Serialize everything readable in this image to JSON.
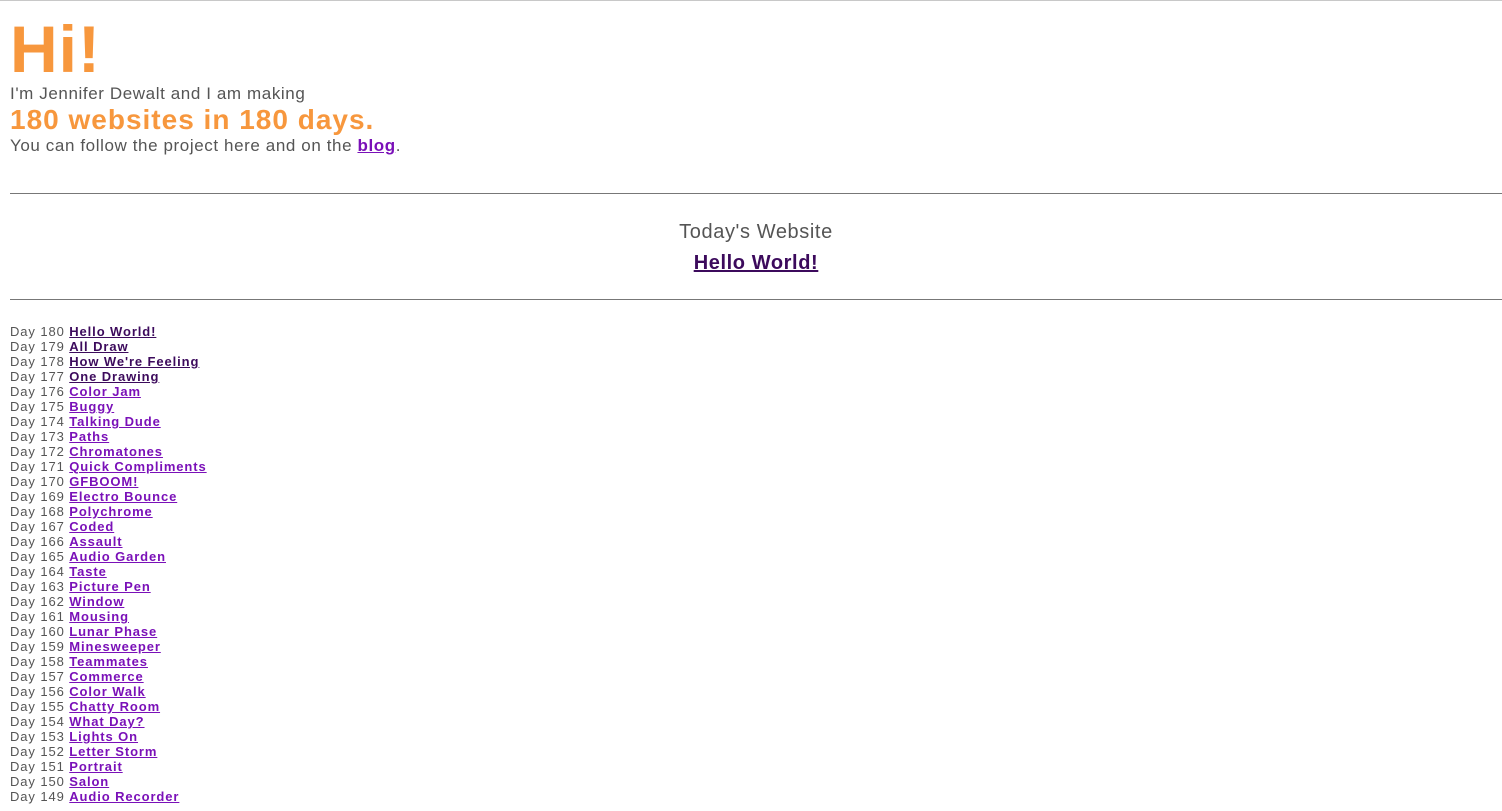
{
  "header": {
    "greeting": "Hi!",
    "intro": "I'm Jennifer Dewalt and I am making",
    "headline": "180 websites in 180 days.",
    "follow_text": "You can follow the project here and on the ",
    "blog_link": "blog",
    "follow_end": "."
  },
  "today": {
    "label": "Today's Website",
    "link": "Hello World!"
  },
  "days": [
    {
      "day": "Day 180",
      "name": "Hello World!",
      "visited": true
    },
    {
      "day": "Day 179",
      "name": "All Draw",
      "visited": true
    },
    {
      "day": "Day 178",
      "name": "How We're Feeling",
      "visited": true
    },
    {
      "day": "Day 177",
      "name": "One Drawing",
      "visited": true
    },
    {
      "day": "Day 176",
      "name": "Color Jam",
      "visited": false
    },
    {
      "day": "Day 175",
      "name": "Buggy",
      "visited": false
    },
    {
      "day": "Day 174",
      "name": "Talking Dude",
      "visited": false
    },
    {
      "day": "Day 173",
      "name": "Paths",
      "visited": false
    },
    {
      "day": "Day 172",
      "name": "Chromatones",
      "visited": false
    },
    {
      "day": "Day 171",
      "name": "Quick Compliments",
      "visited": false
    },
    {
      "day": "Day 170",
      "name": "GFBOOM!",
      "visited": false
    },
    {
      "day": "Day 169",
      "name": "Electro Bounce",
      "visited": false
    },
    {
      "day": "Day 168",
      "name": "Polychrome",
      "visited": false
    },
    {
      "day": "Day 167",
      "name": "Coded",
      "visited": false
    },
    {
      "day": "Day 166",
      "name": "Assault",
      "visited": false
    },
    {
      "day": "Day 165",
      "name": "Audio Garden",
      "visited": false
    },
    {
      "day": "Day 164",
      "name": "Taste",
      "visited": false
    },
    {
      "day": "Day 163",
      "name": "Picture Pen",
      "visited": false
    },
    {
      "day": "Day 162",
      "name": "Window",
      "visited": false
    },
    {
      "day": "Day 161",
      "name": "Mousing",
      "visited": false
    },
    {
      "day": "Day 160",
      "name": "Lunar Phase",
      "visited": false
    },
    {
      "day": "Day 159",
      "name": "Minesweeper",
      "visited": false
    },
    {
      "day": "Day 158",
      "name": "Teammates",
      "visited": false
    },
    {
      "day": "Day 157",
      "name": "Commerce",
      "visited": false
    },
    {
      "day": "Day 156",
      "name": "Color Walk",
      "visited": false
    },
    {
      "day": "Day 155",
      "name": "Chatty Room",
      "visited": false
    },
    {
      "day": "Day 154",
      "name": "What Day?",
      "visited": false
    },
    {
      "day": "Day 153",
      "name": "Lights On",
      "visited": false
    },
    {
      "day": "Day 152",
      "name": "Letter Storm",
      "visited": false
    },
    {
      "day": "Day 151",
      "name": "Portrait",
      "visited": false
    },
    {
      "day": "Day 150",
      "name": "Salon",
      "visited": false
    },
    {
      "day": "Day 149",
      "name": "Audio Recorder",
      "visited": false
    }
  ],
  "colors": {
    "accent": "#f7973d",
    "text": "#555555",
    "link": "#7a10b8",
    "link_visited": "#3c0a5c"
  }
}
